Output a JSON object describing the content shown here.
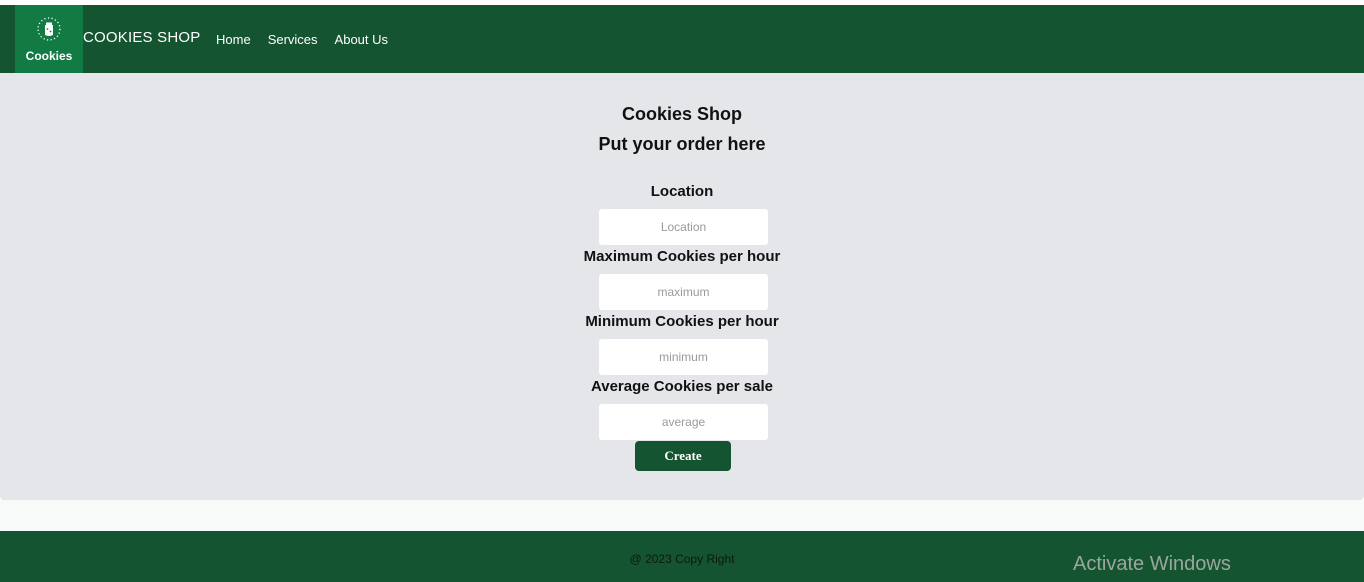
{
  "header": {
    "logo_label": "Cookies",
    "brand": "COOKIES SHOP",
    "nav": [
      {
        "label": "Home"
      },
      {
        "label": "Services"
      },
      {
        "label": "About Us"
      }
    ],
    "icon": "cookie-jar-icon",
    "colors": {
      "bar": "#155430",
      "logo": "#127a43"
    }
  },
  "main": {
    "title": "Cookies Shop",
    "subtitle": "Put your order here",
    "fields": {
      "location": {
        "label": "Location",
        "placeholder": "Location",
        "value": ""
      },
      "maximum": {
        "label": "Maximum Cookies per hour",
        "placeholder": "maximum",
        "value": ""
      },
      "minimum": {
        "label": "Minimum Cookies per hour",
        "placeholder": "minimum",
        "value": ""
      },
      "average": {
        "label": "Average Cookies per sale",
        "placeholder": "average",
        "value": ""
      }
    },
    "create_label": "Create",
    "colors": {
      "background": "#e5e6ea",
      "button": "#155430"
    }
  },
  "footer": {
    "copyright": "@ 2023 Copy Right",
    "watermark": "Activate Windows",
    "colors": {
      "bar": "#155430"
    }
  }
}
